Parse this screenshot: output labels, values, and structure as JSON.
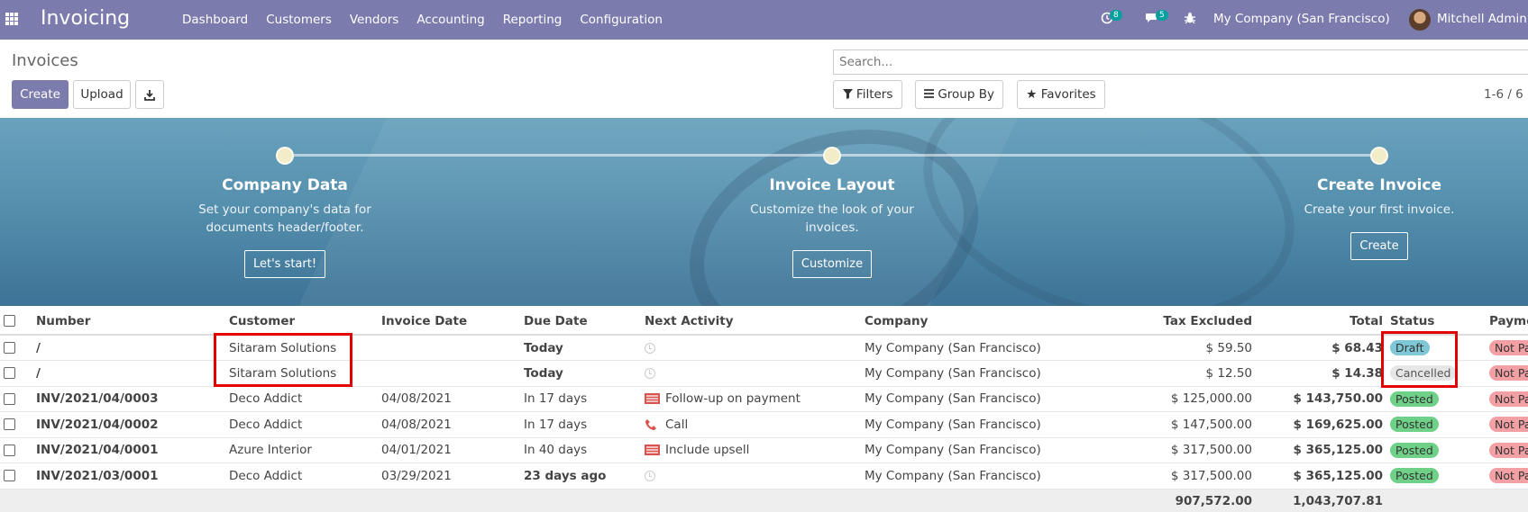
{
  "navbar": {
    "brand": "Invoicing",
    "menu": [
      "Dashboard",
      "Customers",
      "Vendors",
      "Accounting",
      "Reporting",
      "Configuration"
    ],
    "activity_count": "8",
    "message_count": "5",
    "company": "My Company (San Francisco)",
    "user": "Mitchell Admin"
  },
  "control_panel": {
    "title": "Invoices",
    "create_label": "Create",
    "upload_label": "Upload",
    "search_placeholder": "Search...",
    "filters_label": "Filters",
    "groupby_label": "Group By",
    "favorites_label": "Favorites",
    "pager": "1-6 / 6"
  },
  "onboarding": {
    "steps": [
      {
        "title": "Company Data",
        "desc1": "Set your company's data for",
        "desc2": "documents header/footer.",
        "button": "Let's start!"
      },
      {
        "title": "Invoice Layout",
        "desc1": "Customize the look of your",
        "desc2": "invoices.",
        "button": "Customize"
      },
      {
        "title": "Create Invoice",
        "desc1": "Create your first invoice.",
        "desc2": "",
        "button": "Create"
      }
    ]
  },
  "table": {
    "columns": [
      "Number",
      "Customer",
      "Invoice Date",
      "Due Date",
      "Next Activity",
      "Company",
      "Tax Excluded",
      "Total",
      "Status",
      "Payme"
    ],
    "rows": [
      {
        "number": "/",
        "customer": "Sitaram Solutions",
        "invoice_date": "",
        "due_date": "Today",
        "activity": "",
        "company": "My Company (San Francisco)",
        "tax_excluded": "$ 59.50",
        "total": "$ 68.43",
        "status": "Draft",
        "payment": "Not Pa"
      },
      {
        "number": "/",
        "customer": "Sitaram Solutions",
        "invoice_date": "",
        "due_date": "Today",
        "activity": "",
        "company": "My Company (San Francisco)",
        "tax_excluded": "$ 12.50",
        "total": "$ 14.38",
        "status": "Cancelled",
        "payment": "Not Pa"
      },
      {
        "number": "INV/2021/04/0003",
        "customer": "Deco Addict",
        "invoice_date": "04/08/2021",
        "due_date": "In 17 days",
        "activity": "Follow-up on payment",
        "company": "My Company (San Francisco)",
        "tax_excluded": "$ 125,000.00",
        "total": "$ 143,750.00",
        "status": "Posted",
        "payment": "Not Pa"
      },
      {
        "number": "INV/2021/04/0002",
        "customer": "Deco Addict",
        "invoice_date": "04/08/2021",
        "due_date": "In 17 days",
        "activity": "Call",
        "company": "My Company (San Francisco)",
        "tax_excluded": "$ 147,500.00",
        "total": "$ 169,625.00",
        "status": "Posted",
        "payment": "Not Pa"
      },
      {
        "number": "INV/2021/04/0001",
        "customer": "Azure Interior",
        "invoice_date": "04/01/2021",
        "due_date": "In 40 days",
        "activity": "Include upsell",
        "company": "My Company (San Francisco)",
        "tax_excluded": "$ 317,500.00",
        "total": "$ 365,125.00",
        "status": "Posted",
        "payment": "Not Pa"
      },
      {
        "number": "INV/2021/03/0001",
        "customer": "Deco Addict",
        "invoice_date": "03/29/2021",
        "due_date": "23 days ago",
        "activity": "",
        "company": "My Company (San Francisco)",
        "tax_excluded": "$ 317,500.00",
        "total": "$ 365,125.00",
        "status": "Posted",
        "payment": "Not Pa"
      }
    ],
    "totals": {
      "tax_excluded": "907,572.00",
      "total": "1,043,707.81"
    }
  }
}
